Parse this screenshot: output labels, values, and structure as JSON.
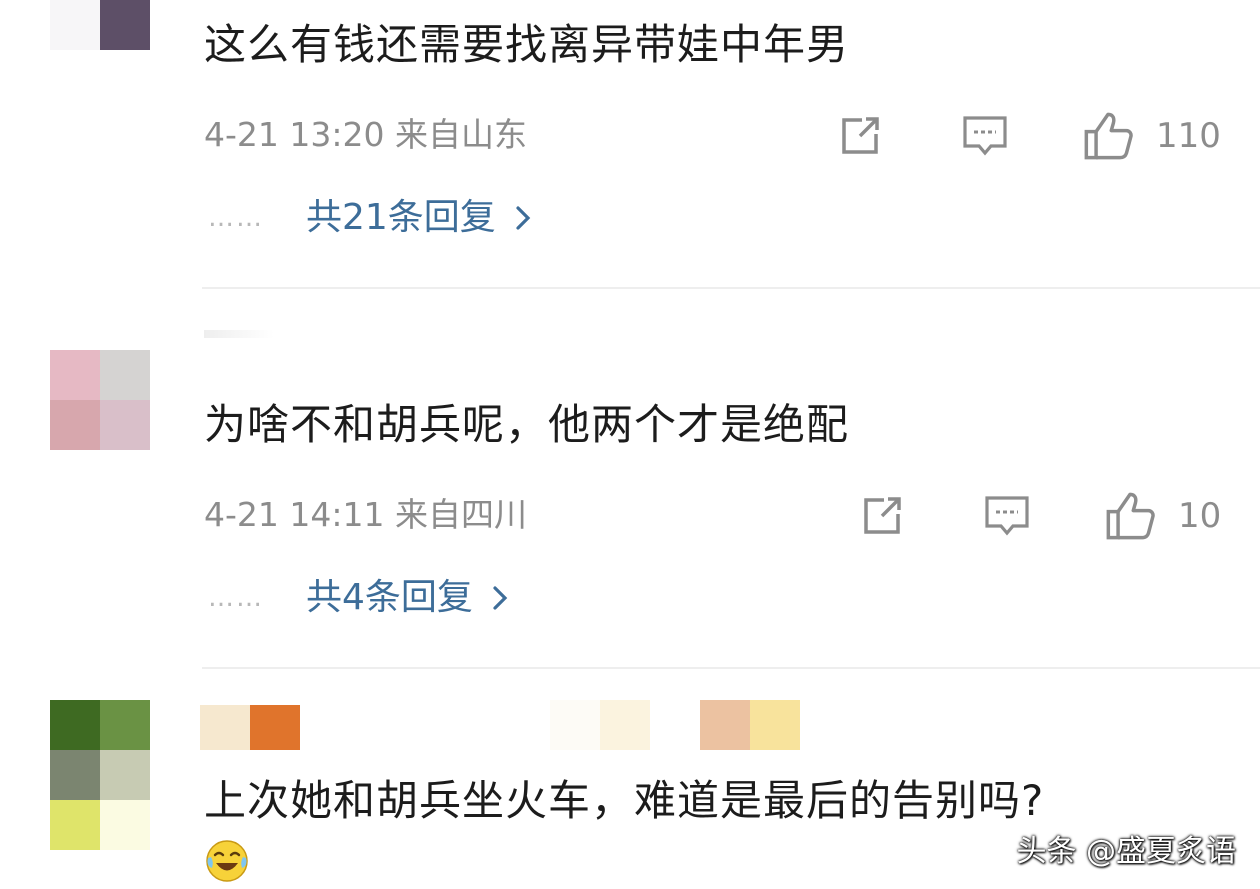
{
  "comments": [
    {
      "text": "这么有钱还需要找离异带娃中年男",
      "meta": "4-21 13:20 来自山东",
      "likes": "110",
      "dots": "……",
      "replies": "共21条回复"
    },
    {
      "text": "为啥不和胡兵呢，他两个才是绝配",
      "meta": "4-21 14:11 来自四川",
      "likes": "10",
      "dots": "……",
      "replies": "共4条回复"
    },
    {
      "text": "上次她和胡兵坐火车，难道是最后的告别吗?"
    }
  ],
  "icons": {
    "share": "share-icon",
    "comment": "comment-icon",
    "like": "thumbs-up-icon",
    "chevron": "chevron-right-icon",
    "emoji": "laughing-crying-emoji-icon"
  },
  "watermark": "头条 @盛夏炙语",
  "colors": {
    "reply_link": "#3d6d99",
    "meta_gray": "#8c8c8c",
    "divider": "#eeeeee"
  }
}
